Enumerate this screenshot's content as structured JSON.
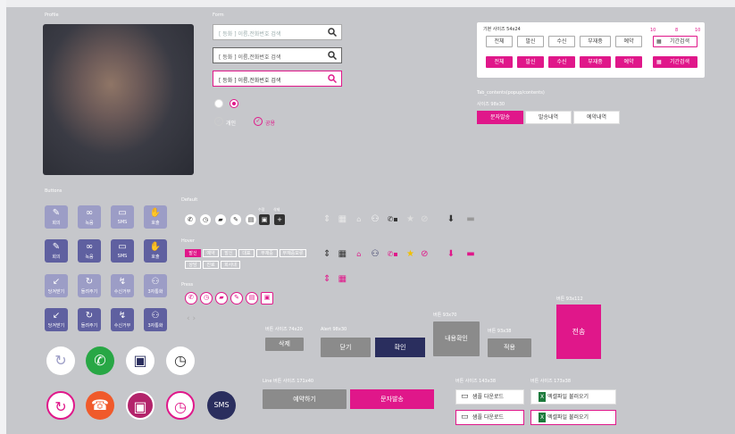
{
  "sections": {
    "profile": "Profile",
    "form": "Form",
    "buttons": "Buttons",
    "default": "Default",
    "hover": "Hover",
    "press": "Press"
  },
  "search": {
    "placeholder": "[ 등화 ] 이름,전화번호 검색",
    "filled": "[ 등화 ] 이름,전화번호 검색"
  },
  "radios": {
    "personal": "개인",
    "common": "공용"
  },
  "tabs_panel": {
    "size_label": "기본 사이즈 54x24",
    "row1": [
      "전체",
      "발신",
      "수신",
      "부재중",
      "예약",
      "기간검색"
    ],
    "row2": [
      "전체",
      "발신",
      "수신",
      "부재중",
      "예약",
      "기간검색"
    ],
    "marks": [
      "10",
      "8",
      "10"
    ]
  },
  "tab_section": {
    "title": "Tab_contents(popup/contents)",
    "size": "사이즈 98x30",
    "tabs": [
      "문자발송",
      "발송내역",
      "예약내역"
    ]
  },
  "icon_buttons": {
    "row1": [
      "회의",
      "녹음",
      "SMS",
      "호출"
    ],
    "row2": [
      "회의",
      "녹음",
      "SMS",
      "호출"
    ],
    "row3": [
      "당겨받기",
      "돌려주기",
      "수신거부",
      "3자통화"
    ],
    "row4": [
      "당겨받기",
      "돌려주기",
      "수신거부",
      "3자통화"
    ]
  },
  "default_labels": {
    "edit": "수정",
    "delete": "삭제"
  },
  "hover_tags": {
    "row1": [
      "발신",
      "예약",
      "발신",
      "대표",
      "부재중",
      "부재중보류"
    ],
    "row2": [
      "상담",
      "진료",
      "회사내"
    ]
  },
  "buttons": {
    "delete_size": "버튼 사이즈 74x20",
    "delete": "삭제",
    "alert_size": "Alert 98x30",
    "close": "닫기",
    "confirm": "확인",
    "detail_size": "버튼 93x70",
    "detail": "내용확인",
    "save_size": "버튼 93x38",
    "save": "적용",
    "send_size": "버튼 93x112",
    "send": "전송",
    "line_size": "Line 버튼 사이즈 171x40",
    "reserve": "예약하기",
    "sms_send": "문자발송",
    "dl_size": "버튼 사이즈 143x38",
    "dl_size2": "버튼 사이즈 173x38",
    "sample_dl": "샘플 다운로드",
    "excel": "엑셀파일 불러오기"
  },
  "colors": {
    "accent": "#e0178a",
    "navy": "#2a2e5e",
    "purple": "#9c9dc6"
  }
}
